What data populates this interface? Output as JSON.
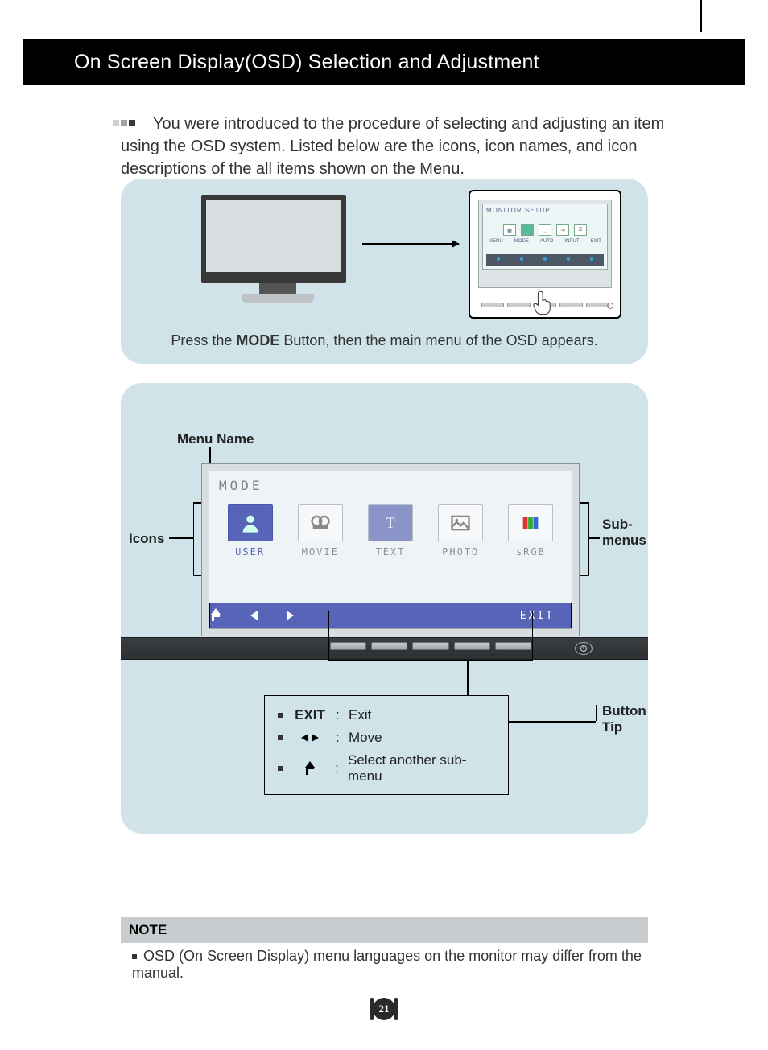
{
  "header": {
    "title": "On Screen Display(OSD) Selection and Adjustment"
  },
  "intro": {
    "text": "You were introduced to the procedure of selecting and adjusting an item using the OSD system. Listed below are the icons, icon names, and icon descriptions of the all items shown on the Menu."
  },
  "panel1": {
    "mini_title": "MONITOR SETUP",
    "mini_labels": [
      "MENU",
      "MODE",
      "AUTO",
      "INPUT",
      "EXIT"
    ],
    "caption_pre": "Press the ",
    "caption_bold": "MODE",
    "caption_post": " Button, then the main menu of the OSD appears."
  },
  "panel2": {
    "labels": {
      "menu_name": "Menu Name",
      "icons": "Icons",
      "submenus": "Sub-menus",
      "button_tip": "Button Tip"
    },
    "osd": {
      "title": "MODE",
      "items": [
        {
          "label": "USER",
          "selected": true
        },
        {
          "label": "MOVIE",
          "selected": false
        },
        {
          "label": "TEXT",
          "selected": false
        },
        {
          "label": "PHOTO",
          "selected": false
        },
        {
          "label": "sRGB",
          "selected": false
        }
      ],
      "rail_exit": "EXIT"
    },
    "tips": {
      "rows": [
        {
          "key_text": "EXIT",
          "desc": "Exit"
        },
        {
          "key_text": "",
          "desc": "Move"
        },
        {
          "key_text": "",
          "desc": "Select another sub-menu"
        }
      ]
    }
  },
  "note": {
    "heading": "NOTE",
    "text": "OSD (On Screen Display) menu languages on the monitor may differ from the manual."
  },
  "page_number": "21"
}
